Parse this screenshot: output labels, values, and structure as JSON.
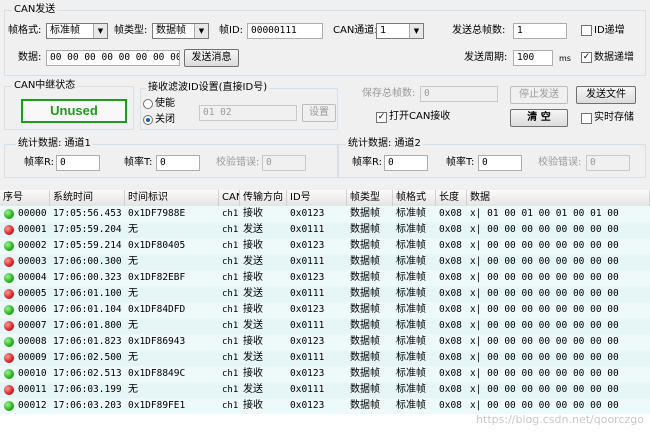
{
  "send": {
    "title": "CAN发送",
    "frame_format_label": "帧格式:",
    "frame_format_value": "标准帧",
    "frame_type_label": "帧类型:",
    "frame_type_value": "数据帧",
    "frame_id_label": "帧ID:",
    "frame_id_value": "00000111",
    "channel_label": "CAN通道:",
    "channel_value": "1",
    "total_frames_label": "发送总帧数:",
    "total_frames_value": "1",
    "id_increment_label": "ID递增",
    "data_label": "数据:",
    "data_value": "00 00 00 00 00 00 00 00",
    "send_msg_button": "发送消息",
    "period_label": "发送周期:",
    "period_value": "100",
    "period_unit": "ms",
    "data_increment_label": "数据递增"
  },
  "relay": {
    "title": "CAN中继状态",
    "status": "Unused"
  },
  "filter": {
    "title": "接收滤波ID设置(直接ID号)",
    "enable_label": "使能",
    "disable_label": "关闭",
    "ids_value": "01 02",
    "set_button": "设置"
  },
  "controls": {
    "saved_frames_label": "保存总帧数:",
    "saved_frames_value": "0",
    "stop_send_button": "停止发送",
    "send_file_button": "发送文件",
    "open_receive_label": "打开CAN接收",
    "clear_button": "清 空",
    "realtime_save_label": "实时存储"
  },
  "stats1": {
    "title": "统计数据: 通道1",
    "frame_rate_r_label": "帧率R:",
    "frame_rate_r_value": "0",
    "frame_rate_t_label": "帧率T:",
    "frame_rate_t_value": "0",
    "checksum_label": "校验错误:",
    "checksum_value": "0"
  },
  "stats2": {
    "title": "统计数据: 通道2",
    "frame_rate_r_label": "帧率R:",
    "frame_rate_r_value": "0",
    "frame_rate_t_label": "帧率T:",
    "frame_rate_t_value": "0",
    "checksum_label": "校验错误:",
    "checksum_value": "0"
  },
  "table": {
    "columns": [
      "序号",
      "系统时间",
      "时间标识",
      "CAN通道",
      "传输方向",
      "ID号",
      "帧类型",
      "帧格式",
      "长度",
      "数据"
    ],
    "rows": [
      {
        "status": "green",
        "cells": [
          "00000",
          "17:05:56.453",
          "0x1DF7988E",
          "ch1",
          "接收",
          "0x0123",
          "数据帧",
          "标准帧",
          "0x08",
          "x| 01 00 01 00 01 00 01 00"
        ]
      },
      {
        "status": "red",
        "cells": [
          "00001",
          "17:05:59.204",
          "无",
          "ch1",
          "发送",
          "0x0111",
          "数据帧",
          "标准帧",
          "0x08",
          "x| 00 00 00 00 00 00 00 00"
        ]
      },
      {
        "status": "green",
        "cells": [
          "00002",
          "17:05:59.214",
          "0x1DF80405",
          "ch1",
          "接收",
          "0x0123",
          "数据帧",
          "标准帧",
          "0x08",
          "x| 00 00 00 00 00 00 00 00"
        ]
      },
      {
        "status": "red",
        "cells": [
          "00003",
          "17:06:00.300",
          "无",
          "ch1",
          "发送",
          "0x0111",
          "数据帧",
          "标准帧",
          "0x08",
          "x| 00 00 00 00 00 00 00 00"
        ]
      },
      {
        "status": "green",
        "cells": [
          "00004",
          "17:06:00.323",
          "0x1DF82EBF",
          "ch1",
          "接收",
          "0x0123",
          "数据帧",
          "标准帧",
          "0x08",
          "x| 00 00 00 00 00 00 00 00"
        ]
      },
      {
        "status": "red",
        "cells": [
          "00005",
          "17:06:01.100",
          "无",
          "ch1",
          "发送",
          "0x0111",
          "数据帧",
          "标准帧",
          "0x08",
          "x| 00 00 00 00 00 00 00 00"
        ]
      },
      {
        "status": "green",
        "cells": [
          "00006",
          "17:06:01.104",
          "0x1DF84DFD",
          "ch1",
          "接收",
          "0x0123",
          "数据帧",
          "标准帧",
          "0x08",
          "x| 00 00 00 00 00 00 00 00"
        ]
      },
      {
        "status": "red",
        "cells": [
          "00007",
          "17:06:01.800",
          "无",
          "ch1",
          "发送",
          "0x0111",
          "数据帧",
          "标准帧",
          "0x08",
          "x| 00 00 00 00 00 00 00 00"
        ]
      },
      {
        "status": "green",
        "cells": [
          "00008",
          "17:06:01.823",
          "0x1DF86943",
          "ch1",
          "接收",
          "0x0123",
          "数据帧",
          "标准帧",
          "0x08",
          "x| 00 00 00 00 00 00 00 00"
        ]
      },
      {
        "status": "red",
        "cells": [
          "00009",
          "17:06:02.500",
          "无",
          "ch1",
          "发送",
          "0x0111",
          "数据帧",
          "标准帧",
          "0x08",
          "x| 00 00 00 00 00 00 00 00"
        ]
      },
      {
        "status": "green",
        "cells": [
          "00010",
          "17:06:02.513",
          "0x1DF8849C",
          "ch1",
          "接收",
          "0x0123",
          "数据帧",
          "标准帧",
          "0x08",
          "x| 00 00 00 00 00 00 00 00"
        ]
      },
      {
        "status": "red",
        "cells": [
          "00011",
          "17:06:03.199",
          "无",
          "ch1",
          "发送",
          "0x0111",
          "数据帧",
          "标准帧",
          "0x08",
          "x| 00 00 00 00 00 00 00 00"
        ]
      },
      {
        "status": "green",
        "cells": [
          "00012",
          "17:06:03.203",
          "0x1DF89FE1",
          "ch1",
          "接收",
          "0x0123",
          "数据帧",
          "标准帧",
          "0x08",
          "x| 00 00 00 00 00 00 00 00"
        ]
      }
    ]
  },
  "watermark": "https://blog.csdn.net/qoorczgo"
}
